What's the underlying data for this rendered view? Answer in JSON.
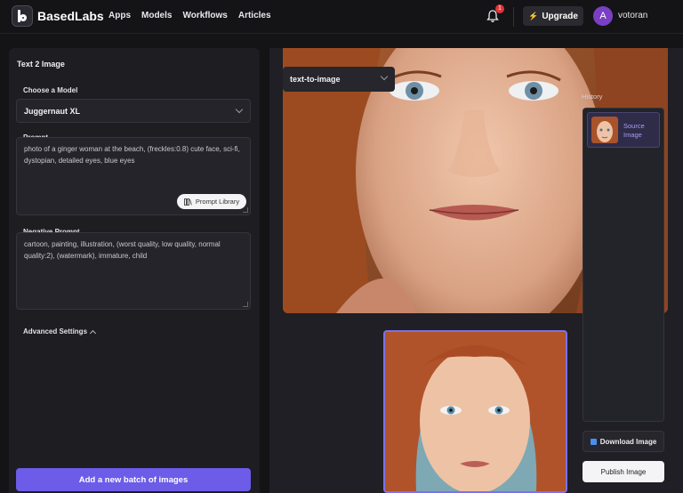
{
  "app": {
    "brand": "BasedLabs",
    "nav": [
      "Apps",
      "Models",
      "Workflows",
      "Articles"
    ],
    "notification_count": "1",
    "upgrade_label": "Upgrade",
    "avatar_initial": "A",
    "username": "votoran"
  },
  "left_panel": {
    "title": "Text 2 Image",
    "model_label": "Choose a Model",
    "model_value": "Juggernaut XL",
    "prompt_label": "Prompt",
    "prompt_text": "photo of a ginger woman at the beach, (freckles:0.8) cute face, sci-fi, dystopian, detailed eyes, blue eyes",
    "prompt_library_label": "Prompt Library",
    "negative_label": "Negative Prompt",
    "negative_text": "cartoon, painting, illustration, (worst quality, low quality, normal quality:2), (watermark), immature, child",
    "advanced_label": "Advanced Settings",
    "batch_button": "Add a new batch of images"
  },
  "right_panel": {
    "mode_value": "text-to-image",
    "history_label": "History",
    "history_items": [
      {
        "label": "Source Image"
      }
    ],
    "download_label": "Download Image",
    "publish_label": "Publish Image"
  },
  "colors": {
    "accent": "#6c5ce7",
    "background": "#141417",
    "panel": "#1d1d22",
    "notification": "#e0343a",
    "avatar": "#7b3fc6"
  },
  "icons": [
    "logo-icon",
    "bell-icon",
    "bolt-icon",
    "chevron-down-icon",
    "book-icon",
    "chevron-up-icon",
    "download-icon"
  ]
}
